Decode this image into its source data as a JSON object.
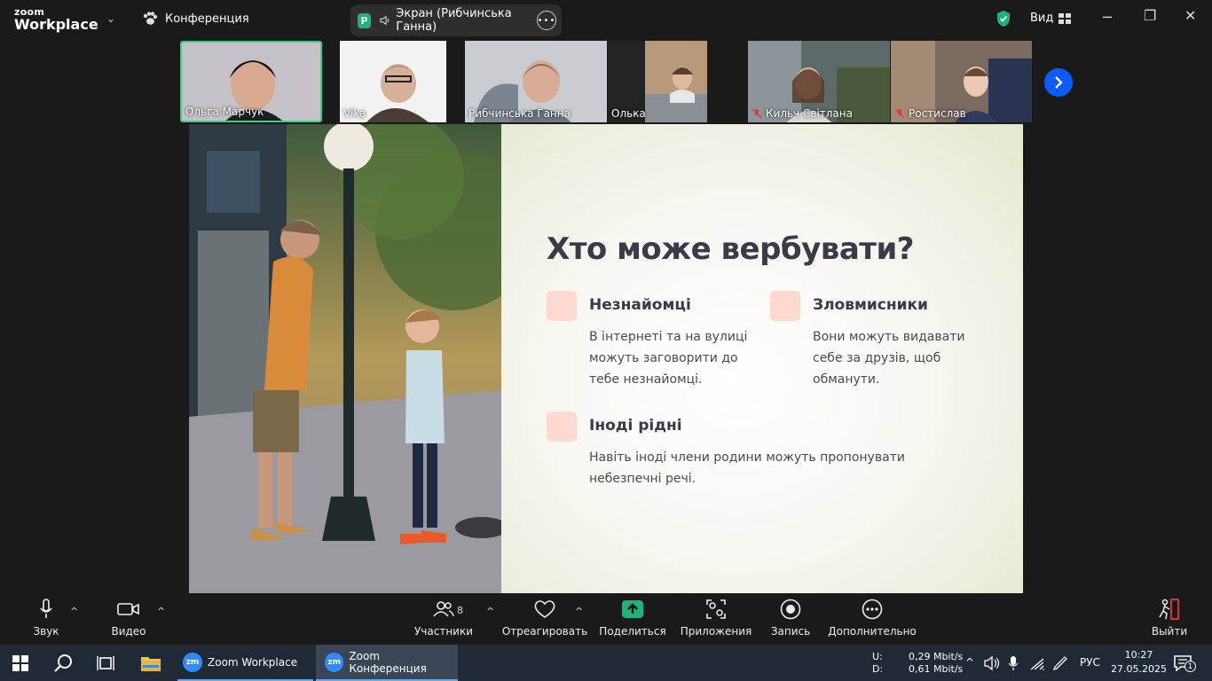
{
  "titlebar": {
    "logo_top": "zoom",
    "logo_bottom": "Workplace",
    "meeting_title": "Конференция",
    "share_badge": "Р",
    "share_label": "Экран (Рибчинська Ганна)",
    "view_label": "Вид",
    "colors": {
      "shield": "#1db37a",
      "share_badge": "#1db37a"
    }
  },
  "participants": [
    {
      "name": "Ольга Марчук",
      "muted": false,
      "active": true
    },
    {
      "name": "Vika",
      "muted": false,
      "active": false
    },
    {
      "name": "Рибчинська Ганна",
      "muted": false,
      "active": false
    },
    {
      "name": "Олька",
      "muted": false,
      "active": false
    },
    {
      "name": "Кильч Світлана",
      "muted": true,
      "active": false
    },
    {
      "name": "Ростислав",
      "muted": true,
      "active": false
    }
  ],
  "slide": {
    "title": "Хто може вербувати?",
    "items": [
      {
        "heading": "Незнайомці",
        "text": "В інтернеті та на вулиці можуть заговорити до тебе незнайомці."
      },
      {
        "heading": "Зловмисники",
        "text": "Вони можуть видавати себе за друзів, щоб обманути."
      },
      {
        "heading": "Іноді рідні",
        "text": "Навіть іноді члени родини можуть пропонувати небезпечні речі."
      }
    ],
    "colors": {
      "title": "#3a3a48",
      "bullet": "#fdd9d0"
    }
  },
  "toolbar": {
    "audio": "Звук",
    "video": "Видео",
    "participants": "Участники",
    "participants_count": "8",
    "react": "Отреагировать",
    "share": "Поделиться",
    "apps": "Приложения",
    "record": "Запись",
    "more": "Дополнительно",
    "leave": "Выйти",
    "colors": {
      "share": "#1db37a",
      "leave": "#e53935"
    }
  },
  "taskbar": {
    "apps": [
      {
        "label": "Zoom Workplace",
        "icon": "zm"
      },
      {
        "label": "Zoom Конференция",
        "icon": "zm"
      }
    ],
    "net_up_label": "U:",
    "net_down_label": "D:",
    "net_up": "0,29 Mbit/s",
    "net_down": "0,61 Mbit/s",
    "lang": "РУС",
    "time": "10:27",
    "date": "27.05.2025",
    "notifications": "1"
  }
}
